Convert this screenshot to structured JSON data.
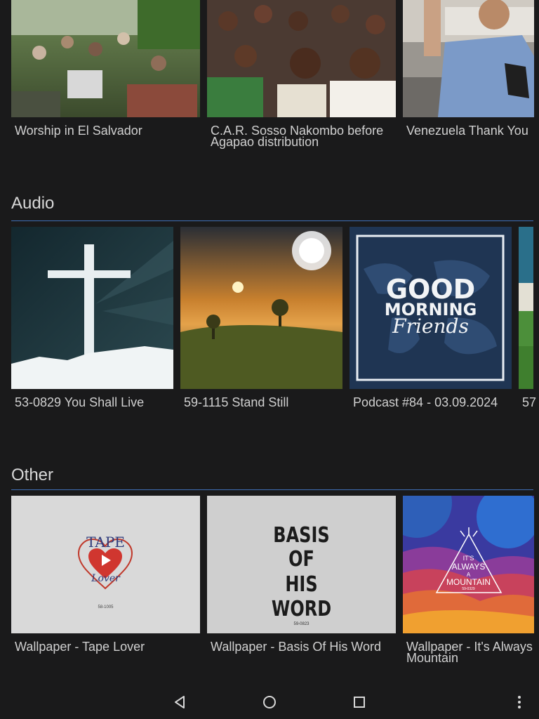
{
  "videos": {
    "items": [
      {
        "title": "Worship in El Salvador"
      },
      {
        "title": "C.A.R. Sosso Nakombo before Agapao distribution"
      },
      {
        "title": "Venezuela Thank You"
      }
    ]
  },
  "audio": {
    "heading": "Audio",
    "items": [
      {
        "title": "53-0829 You Shall Live"
      },
      {
        "title": "59-1115 Stand Still"
      },
      {
        "title": "Podcast #84 - 03.09.2024",
        "art_line1": "GOOD",
        "art_line2": "MORNING",
        "art_line3": "Friends"
      },
      {
        "title": "57"
      }
    ]
  },
  "other": {
    "heading": "Other",
    "items": [
      {
        "title": "Wallpaper - Tape Lover",
        "art_top": "TAPE",
        "art_bottom": "Lover",
        "art_code": "58-1005"
      },
      {
        "title": "Wallpaper - Basis Of His Word",
        "art_line1": "BASIS",
        "art_line2": "OF",
        "art_line3": "HIS",
        "art_line4": "WORD",
        "art_code": "59-0823"
      },
      {
        "title": "Wallpaper - It's Always Mountain",
        "art_line1": "IT'S",
        "art_line2": "ALWAYS",
        "art_line3": "A",
        "art_line4": "MOUNTAIN",
        "art_code": "59-0329"
      }
    ]
  },
  "navbar": {
    "back_icon": "back-triangle-icon",
    "home_icon": "home-circle-icon",
    "recents_icon": "recents-square-icon",
    "menu_icon": "overflow-menu-icon"
  },
  "colors": {
    "background": "#1a1a1b",
    "accent_rule": "#3f6fb6",
    "text": "#d6d6d6"
  }
}
